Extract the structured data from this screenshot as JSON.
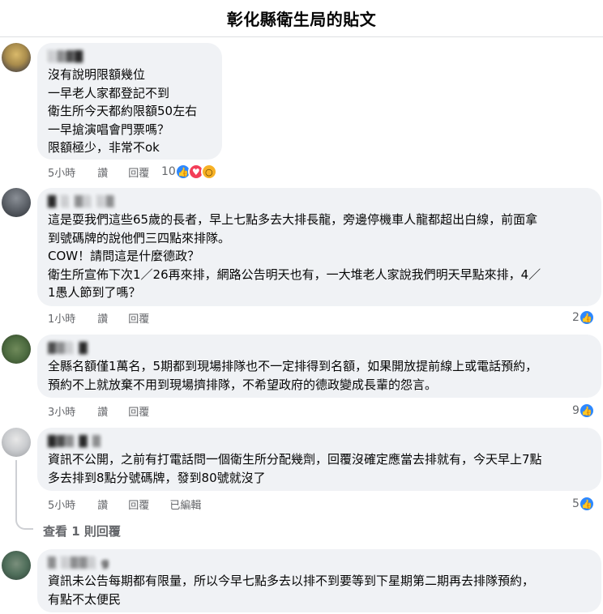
{
  "header": {
    "title": "彰化縣衛生局的貼文"
  },
  "comments": [
    {
      "name": "░▒▓█",
      "lines": [
        "沒有說明限額幾位",
        "一早老人家都登記不到",
        "衛生所今天都約限額50左右",
        "一早搶演唱會門票嗎？",
        "限額極少，非常不ok"
      ],
      "time": "5小時",
      "like": "讚",
      "reply": "回覆",
      "reaction_count": "10",
      "reaction_icons": [
        "like-icon",
        "love-icon",
        "wow-icon"
      ]
    },
    {
      "name": "█ ░ ▒░ ░▒",
      "lines": [
        "這是耍我們這些65歲的長者，早上七點多去大排長龍，旁邊停機車人龍都超出白線，前面拿",
        "到號碼牌的說他們三四點來排隊。",
        "COW！請問這是什麼德政？",
        "衛生所宣佈下次1／26再來排，網路公告明天也有，一大堆老人家說我們明天早點來排，4／",
        "1愚人節到了嗎？"
      ],
      "time": "1小時",
      "like": "讚",
      "reply": "回覆",
      "reaction_count": "2",
      "reaction_icons": [
        "like-icon"
      ]
    },
    {
      "name": "▓▒░ █",
      "lines": [
        "全縣名額僅1萬名，5期都到現場排隊也不一定排得到名額，如果開放提前線上或電話預約，",
        "預約不上就放棄不用到現場擠排隊，不希望政府的德政變成長輩的怨言。"
      ],
      "time": "3小時",
      "like": "讚",
      "reply": "回覆",
      "reaction_count": "9",
      "reaction_icons": [
        "like-icon"
      ]
    },
    {
      "name": "█▓▒ █ ▒",
      "lines": [
        "資訊不公開，之前有打電話問一個衛生所分配幾劑，回覆沒確定應當去排就有，今天早上7點",
        "多去排到8點分號碼牌，發到80號就沒了"
      ],
      "time": "5小時",
      "like": "讚",
      "reply": "回覆",
      "edited": "已編輯",
      "reaction_count": "5",
      "reaction_icons": [
        "like-icon"
      ],
      "view_replies": "查看 1 則回覆"
    },
    {
      "name": "▒ ░▒▒░ g",
      "lines": [
        "資訊未公告每期都有限量，所以今早七點多去以排不到要等到下星期第二期再去排隊預約，",
        "有點不太便民"
      ]
    }
  ],
  "colors": {
    "bubble": "#f0f2f5",
    "meta_text": "#65676b",
    "like_blue": "#2d88ff",
    "love_red": "#f33e58",
    "wow_yellow": "#f7b125"
  }
}
